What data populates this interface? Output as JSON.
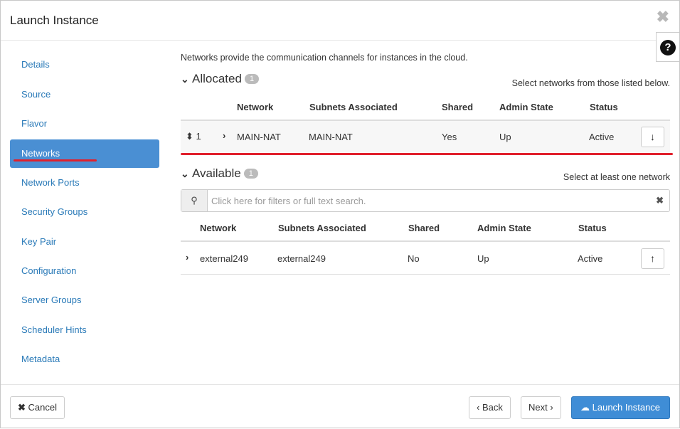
{
  "modal": {
    "title": "Launch Instance",
    "close_glyph": "✖",
    "help_glyph": "?"
  },
  "sidebar": {
    "items": [
      {
        "label": "Details"
      },
      {
        "label": "Source"
      },
      {
        "label": "Flavor"
      },
      {
        "label": "Networks",
        "active": true
      },
      {
        "label": "Network Ports"
      },
      {
        "label": "Security Groups"
      },
      {
        "label": "Key Pair"
      },
      {
        "label": "Configuration"
      },
      {
        "label": "Server Groups"
      },
      {
        "label": "Scheduler Hints"
      },
      {
        "label": "Metadata"
      }
    ]
  },
  "main": {
    "intro": "Networks provide the communication channels for instances in the cloud.",
    "allocated": {
      "title": "Allocated",
      "count": "1",
      "hint": "Select networks from those listed below.",
      "columns": [
        "Network",
        "Subnets Associated",
        "Shared",
        "Admin State",
        "Status"
      ],
      "rows": [
        {
          "order": "1",
          "network": "MAIN-NAT",
          "subnets": "MAIN-NAT",
          "shared": "Yes",
          "admin_state": "Up",
          "status": "Active"
        }
      ]
    },
    "available": {
      "title": "Available",
      "count": "1",
      "hint": "Select at least one network",
      "search_placeholder": "Click here for filters or full text search.",
      "columns": [
        "Network",
        "Subnets Associated",
        "Shared",
        "Admin State",
        "Status"
      ],
      "rows": [
        {
          "network": "external249",
          "subnets": "external249",
          "shared": "No",
          "admin_state": "Up",
          "status": "Active"
        }
      ]
    }
  },
  "footer": {
    "cancel": "Cancel",
    "back": "Back",
    "next": "Next",
    "launch": "Launch Instance"
  },
  "colors": {
    "accent": "#4a8fd3",
    "primary_button": "#3f8dd6",
    "annotation_red": "#e0202c"
  }
}
